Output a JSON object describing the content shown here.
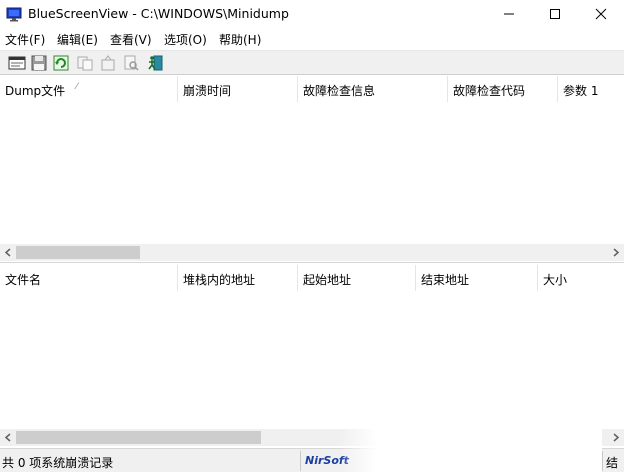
{
  "window": {
    "app_name": "BlueScreenView",
    "title": "BlueScreenView  -  C:\\WINDOWS\\Minidump"
  },
  "menu": [
    "文件(F)",
    "编辑(E)",
    "查看(V)",
    "选项(O)",
    "帮助(H)"
  ],
  "toolbar": {
    "buttons": [
      "html-report-icon",
      "save-icon",
      "refresh-icon",
      "copy-icon",
      "properties-icon",
      "find-icon",
      "exit-icon"
    ]
  },
  "top_table": {
    "columns": [
      "Dump文件",
      "崩溃时间",
      "故障检查信息",
      "故障检查代码",
      "参数 1"
    ],
    "sort_indicator": "⁄"
  },
  "bottom_table": {
    "columns": [
      "文件名",
      "堆栈内的地址",
      "起始地址",
      "结束地址",
      "大小"
    ]
  },
  "statusbar": {
    "count": "共 0 项系统崩溃记录",
    "link": "NirSoft",
    "tail": "结"
  },
  "colors": {
    "toolbar_bg": "#f0f0f0",
    "scroll_thumb": "#cdcdcd",
    "link": "#1b3fa0",
    "app_icon_blue": "#1f3fbf"
  }
}
